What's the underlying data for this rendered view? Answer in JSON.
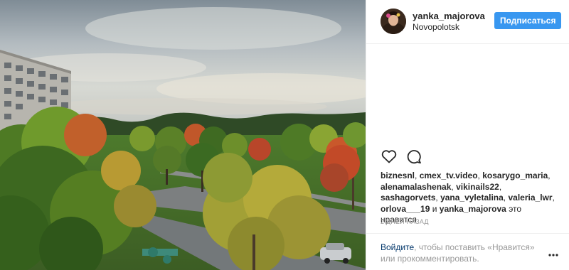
{
  "post": {
    "photo": {
      "alt": ""
    },
    "author": {
      "username": "yanka_majorova",
      "location": "Novopolotsk"
    },
    "follow_label": "Подписаться",
    "likes": {
      "names": [
        "biznesnl",
        "cmex_tv.video",
        "kosarygo_maria",
        "alenamalashenak",
        "vikinails22",
        "sashagorvets",
        "yana_vyletalina",
        "valeria_lwr",
        "orlova___19",
        "yanka_majorova"
      ],
      "separator": ",",
      "conjunction": "и",
      "suffix": "это нравится"
    },
    "date": "2 ДНЕЙ НАЗАД",
    "login_prompt": {
      "link": "Войдите",
      "text": ", чтобы поставить «Нравится» или прокомментировать."
    },
    "icons": {
      "like": "heart-icon",
      "comment": "comment-icon",
      "more": "more-options-icon"
    }
  },
  "colors": {
    "accent": "#3897f0",
    "link": "#003569",
    "muted": "#999999",
    "text": "#262626"
  }
}
